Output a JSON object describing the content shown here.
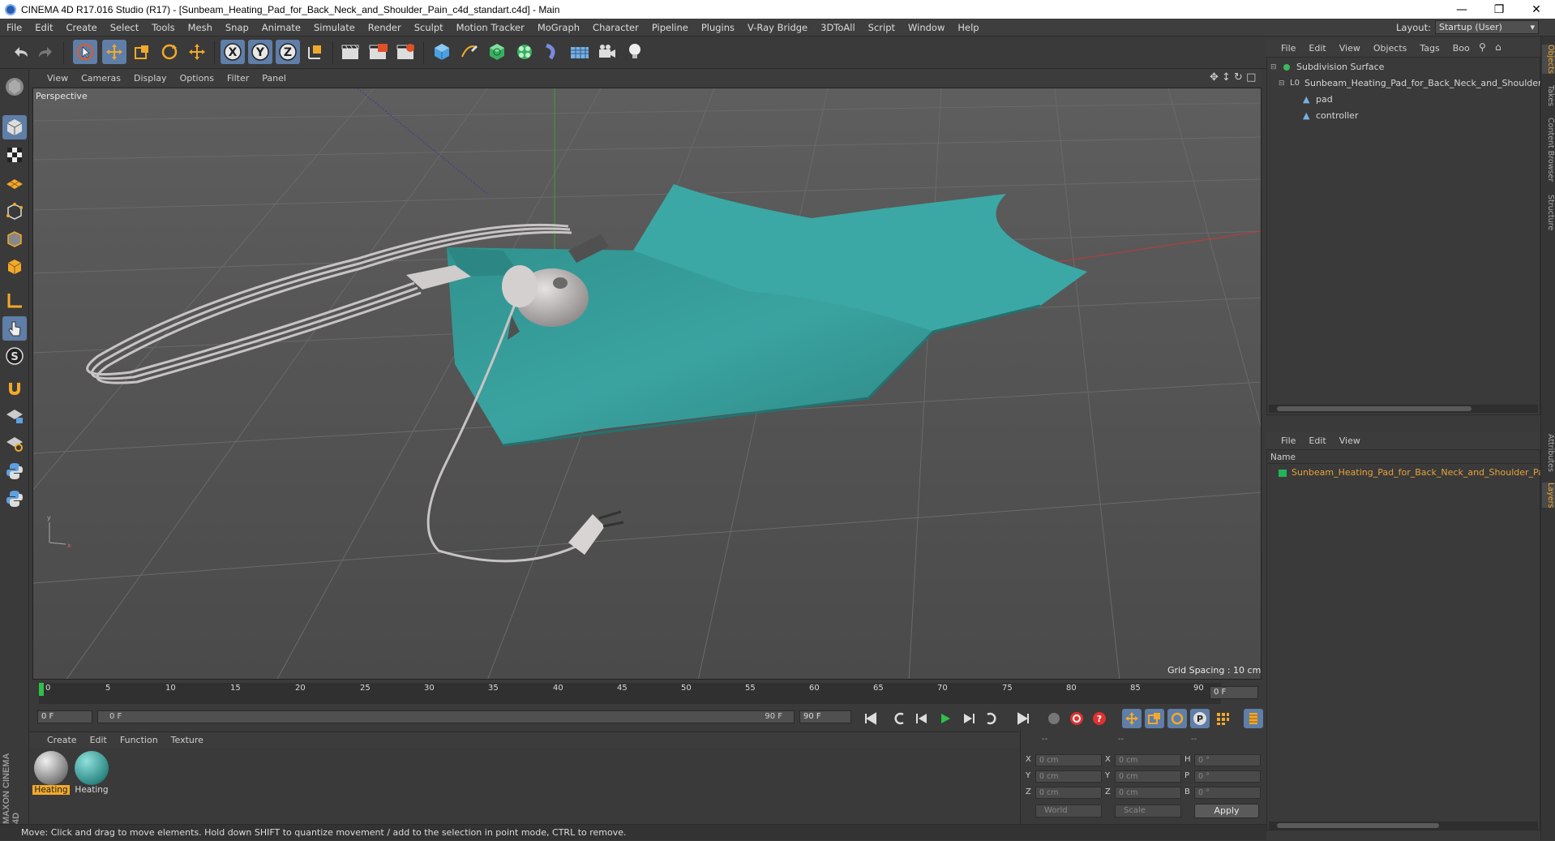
{
  "window": {
    "title": "CINEMA 4D R17.016 Studio (R17) - [Sunbeam_Heating_Pad_for_Back_Neck_and_Shoulder_Pain_c4d_standart.c4d] - Main"
  },
  "menubar": {
    "items": [
      "File",
      "Edit",
      "Create",
      "Select",
      "Tools",
      "Mesh",
      "Snap",
      "Animate",
      "Simulate",
      "Render",
      "Sculpt",
      "Motion Tracker",
      "MoGraph",
      "Character",
      "Pipeline",
      "Plugins",
      "V-Ray Bridge",
      "3DToAll",
      "Script",
      "Window",
      "Help"
    ],
    "layout_label": "Layout:",
    "layout_value": "Startup (User)"
  },
  "toolbar": {
    "axis_labels": [
      "X",
      "Y",
      "Z"
    ]
  },
  "viewport": {
    "menu": [
      "View",
      "Cameras",
      "Display",
      "Options",
      "Filter",
      "Panel"
    ],
    "camera_label": "Perspective",
    "grid_spacing": "Grid Spacing : 10 cm"
  },
  "timeline": {
    "ticks": [
      "0",
      "5",
      "10",
      "15",
      "20",
      "25",
      "30",
      "35",
      "40",
      "45",
      "50",
      "55",
      "60",
      "65",
      "70",
      "75",
      "80",
      "85",
      "90"
    ],
    "current_frame": "0 F",
    "start_field": "0 F",
    "slider_start": "0 F",
    "slider_end": "90 F",
    "end_field": "90 F"
  },
  "material_manager": {
    "menu": [
      "Create",
      "Edit",
      "Function",
      "Texture"
    ],
    "materials": [
      {
        "name": "Heating",
        "color": "#bdbdbd"
      },
      {
        "name": "Heating",
        "color": "#2f8a86"
      }
    ]
  },
  "coordinates": {
    "header": [
      "--",
      "--",
      "--"
    ],
    "rows": [
      {
        "a": "X",
        "a_val": "0 cm",
        "b": "X",
        "b_val": "0 cm",
        "c": "H",
        "c_val": "0 °"
      },
      {
        "a": "Y",
        "a_val": "0 cm",
        "b": "Y",
        "b_val": "0 cm",
        "c": "P",
        "c_val": "0 °"
      },
      {
        "a": "Z",
        "a_val": "0 cm",
        "b": "Z",
        "b_val": "0 cm",
        "c": "B",
        "c_val": "0 °"
      }
    ],
    "mode_world": "World",
    "mode_scale": "Scale",
    "apply": "Apply"
  },
  "object_manager": {
    "menu": [
      "File",
      "Edit",
      "View",
      "Objects",
      "Tags",
      "Boo"
    ],
    "tree": [
      {
        "name": "Subdivision Surface",
        "depth": 0
      },
      {
        "name": "Sunbeam_Heating_Pad_for_Back_Neck_and_Shoulder_Pa",
        "depth": 1
      },
      {
        "name": "pad",
        "depth": 2
      },
      {
        "name": "controller",
        "depth": 2
      }
    ]
  },
  "layer_manager": {
    "menu": [
      "File",
      "Edit",
      "View"
    ],
    "column": "Name",
    "layers": [
      {
        "name": "Sunbeam_Heating_Pad_for_Back_Neck_and_Shoulder_Pai",
        "color": "#24b35a"
      }
    ]
  },
  "right_tabs": [
    "Objects",
    "Takes",
    "Content Browser",
    "Structure",
    "Attributes",
    "Layers"
  ],
  "maxon_logo": "MAXON CINEMA 4D",
  "status": "Move: Click and drag to move elements. Hold down SHIFT to quantize movement / add to the selection in point mode, CTRL to remove.",
  "colors": {
    "accent": "#5f7ea8",
    "pad_teal": "#3a9a98",
    "layer_text": "#e8a33a"
  }
}
